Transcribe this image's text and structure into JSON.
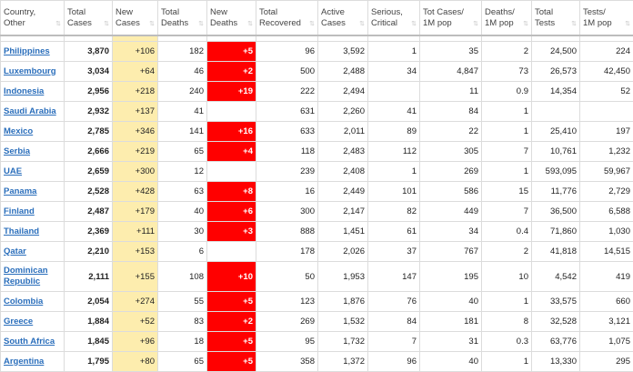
{
  "headers": [
    {
      "line1": "Country,",
      "line2": "Other"
    },
    {
      "line1": "Total",
      "line2": "Cases"
    },
    {
      "line1": "New",
      "line2": "Cases"
    },
    {
      "line1": "Total",
      "line2": "Deaths"
    },
    {
      "line1": "New",
      "line2": "Deaths"
    },
    {
      "line1": "Total",
      "line2": "Recovered"
    },
    {
      "line1": "Active",
      "line2": "Cases"
    },
    {
      "line1": "Serious,",
      "line2": "Critical"
    },
    {
      "line1": "Tot Cases/",
      "line2": "1M pop"
    },
    {
      "line1": "Deaths/",
      "line2": "1M pop"
    },
    {
      "line1": "Total",
      "line2": "Tests"
    },
    {
      "line1": "Tests/",
      "line2": "1M pop"
    }
  ],
  "sort_glyph": "⇅",
  "rows": [
    [
      "Philippines",
      "3,870",
      "+106",
      "182",
      "+5",
      "96",
      "3,592",
      "1",
      "35",
      "2",
      "24,500",
      "224"
    ],
    [
      "Luxembourg",
      "3,034",
      "+64",
      "46",
      "+2",
      "500",
      "2,488",
      "34",
      "4,847",
      "73",
      "26,573",
      "42,450"
    ],
    [
      "Indonesia",
      "2,956",
      "+218",
      "240",
      "+19",
      "222",
      "2,494",
      "",
      "11",
      "0.9",
      "14,354",
      "52"
    ],
    [
      "Saudi Arabia",
      "2,932",
      "+137",
      "41",
      "",
      "631",
      "2,260",
      "41",
      "84",
      "1",
      "",
      ""
    ],
    [
      "Mexico",
      "2,785",
      "+346",
      "141",
      "+16",
      "633",
      "2,011",
      "89",
      "22",
      "1",
      "25,410",
      "197"
    ],
    [
      "Serbia",
      "2,666",
      "+219",
      "65",
      "+4",
      "118",
      "2,483",
      "112",
      "305",
      "7",
      "10,761",
      "1,232"
    ],
    [
      "UAE",
      "2,659",
      "+300",
      "12",
      "",
      "239",
      "2,408",
      "1",
      "269",
      "1",
      "593,095",
      "59,967"
    ],
    [
      "Panama",
      "2,528",
      "+428",
      "63",
      "+8",
      "16",
      "2,449",
      "101",
      "586",
      "15",
      "11,776",
      "2,729"
    ],
    [
      "Finland",
      "2,487",
      "+179",
      "40",
      "+6",
      "300",
      "2,147",
      "82",
      "449",
      "7",
      "36,500",
      "6,588"
    ],
    [
      "Thailand",
      "2,369",
      "+111",
      "30",
      "+3",
      "888",
      "1,451",
      "61",
      "34",
      "0.4",
      "71,860",
      "1,030"
    ],
    [
      "Qatar",
      "2,210",
      "+153",
      "6",
      "",
      "178",
      "2,026",
      "37",
      "767",
      "2",
      "41,818",
      "14,515"
    ],
    [
      "Dominican Republic",
      "2,111",
      "+155",
      "108",
      "+10",
      "50",
      "1,953",
      "147",
      "195",
      "10",
      "4,542",
      "419"
    ],
    [
      "Colombia",
      "2,054",
      "+274",
      "55",
      "+5",
      "123",
      "1,876",
      "76",
      "40",
      "1",
      "33,575",
      "660"
    ],
    [
      "Greece",
      "1,884",
      "+52",
      "83",
      "+2",
      "269",
      "1,532",
      "84",
      "181",
      "8",
      "32,528",
      "3,121"
    ],
    [
      "South Africa",
      "1,845",
      "+96",
      "18",
      "+5",
      "95",
      "1,732",
      "7",
      "31",
      "0.3",
      "63,776",
      "1,075"
    ],
    [
      "Argentina",
      "1,795",
      "+80",
      "65",
      "+5",
      "358",
      "1,372",
      "96",
      "40",
      "1",
      "13,330",
      "295"
    ]
  ]
}
